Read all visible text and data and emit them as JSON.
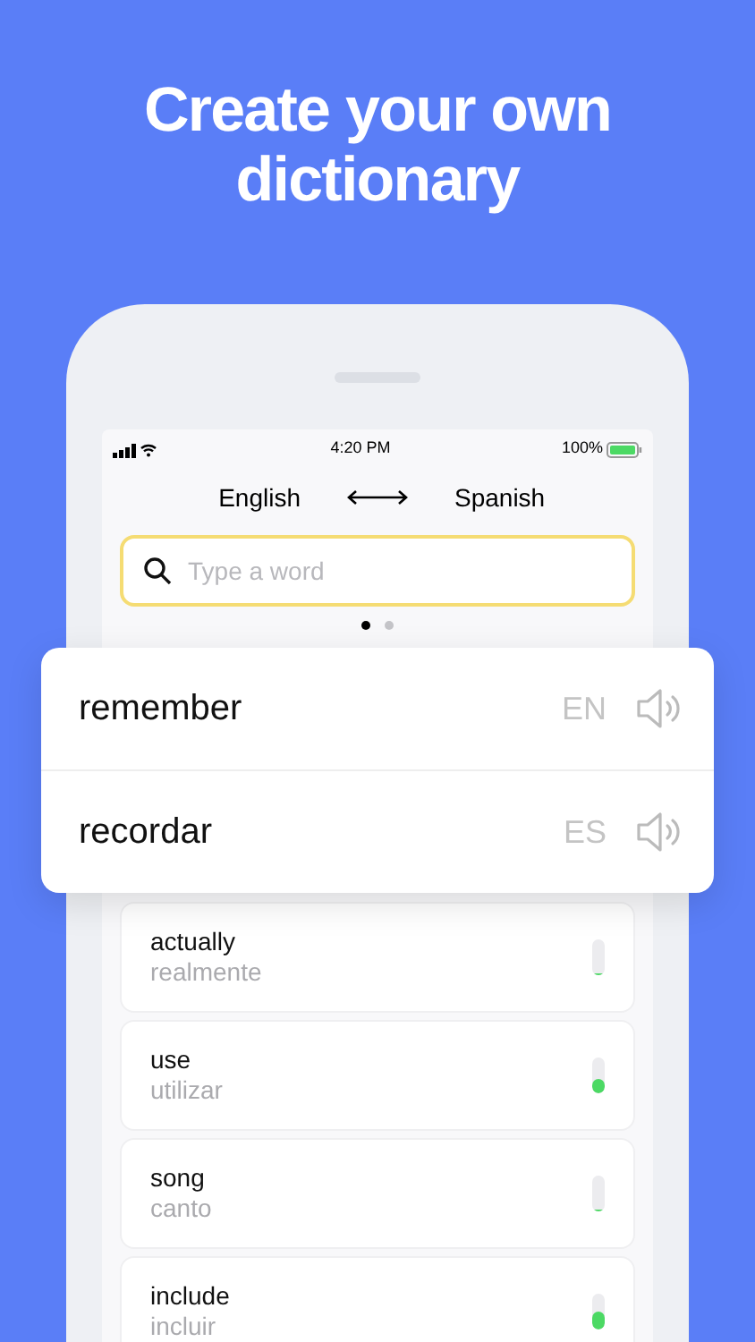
{
  "headline": "Create your own dictionary",
  "status_bar": {
    "time": "4:20 PM",
    "battery": "100%"
  },
  "languages": {
    "from": "English",
    "to": "Spanish"
  },
  "search": {
    "placeholder": "Type a word"
  },
  "pager": [
    {
      "selected": true
    },
    {
      "selected": false
    }
  ],
  "translation_card": [
    {
      "word": "remember",
      "lang": "EN"
    },
    {
      "word": "recordar",
      "lang": "ES"
    }
  ],
  "words": [
    {
      "word": "actually",
      "translation": "realmente",
      "level": 0
    },
    {
      "word": "use",
      "translation": "utilizar",
      "level": 0.4
    },
    {
      "word": "song",
      "translation": "canto",
      "level": 0
    },
    {
      "word": "include",
      "translation": "incluir",
      "level": 0.5
    }
  ]
}
